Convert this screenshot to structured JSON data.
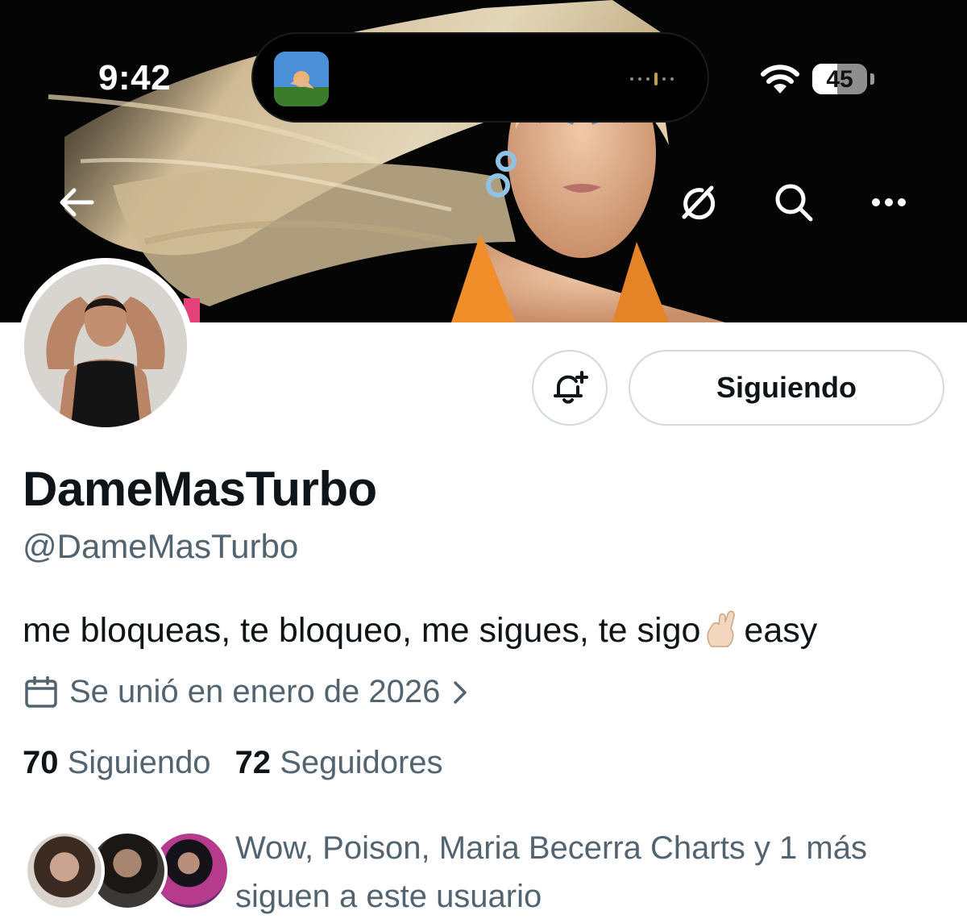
{
  "status_bar": {
    "time": "9:42",
    "battery_level": "45",
    "battery_fraction": 0.45
  },
  "nav": {
    "back_icon": "arrow-left-icon",
    "grok_icon": "grok-icon",
    "search_icon": "search-icon",
    "more_icon": "more-horizontal-icon"
  },
  "actions": {
    "bell_icon": "bell-plus-icon",
    "follow_label": "Siguiendo"
  },
  "profile": {
    "display_name": "DameMasTurbo",
    "handle": "@DameMasTurbo",
    "bio_before": "me bloqueas, te bloqueo, me sigues, te sigo",
    "bio_emoji": "crossed-fingers-emoji",
    "bio_after": "easy",
    "joined": "Se unió en enero de 2026",
    "joined_icon": "calendar-icon"
  },
  "stats": {
    "following_count": "70",
    "following_label": "Siguiendo",
    "followers_count": "72",
    "followers_label": "Seguidores"
  },
  "known_followers": {
    "text_line1": "Wow, Poison, Maria Becerra Charts y 1 más",
    "text_line2": "siguen a este usuario"
  },
  "colors": {
    "text_primary": "#0f1419",
    "text_secondary": "#536471",
    "border": "#cfd9de",
    "banner_bg": "#050505"
  }
}
